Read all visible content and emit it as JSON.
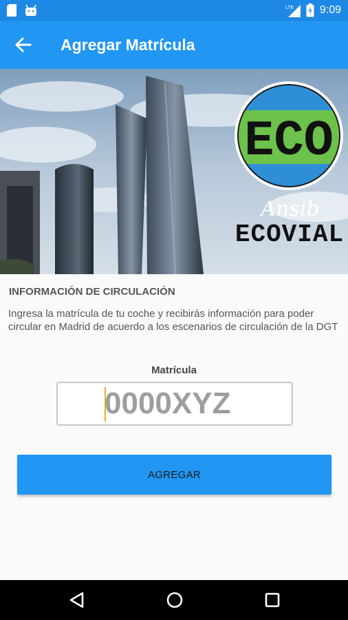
{
  "status_bar": {
    "time": "9:09",
    "left_icons": [
      "sd-card-icon",
      "android-icon"
    ],
    "right_icons": [
      "lte-signal-icon",
      "battery-icon"
    ],
    "network_label": "LTE"
  },
  "app_bar": {
    "title": "Agregar Matrícula",
    "back_icon": "arrow-back-icon",
    "background": "#2196f3"
  },
  "banner": {
    "logo_main_text": "ECO",
    "logo_sub_text": "Ansib",
    "logo_brand_text": "ECOVIAL",
    "logo_colors": {
      "blue": "#2f8fd6",
      "green": "#6cc24a"
    }
  },
  "main": {
    "section_title": "INFORMACIÓN DE CIRCULACIÓN",
    "description": "Ingresa la matrícula de tu coche y recibirás información para poder circular en Madrid de acuerdo a los escenarios de circulación de la DGT",
    "plate_label": "Matrícula",
    "plate_placeholder": "0000XYZ",
    "plate_value": "",
    "add_button_label": "AGREGAR"
  },
  "nav_bar": {
    "icons": [
      "back-triangle-icon",
      "home-circle-icon",
      "recents-square-icon"
    ]
  }
}
